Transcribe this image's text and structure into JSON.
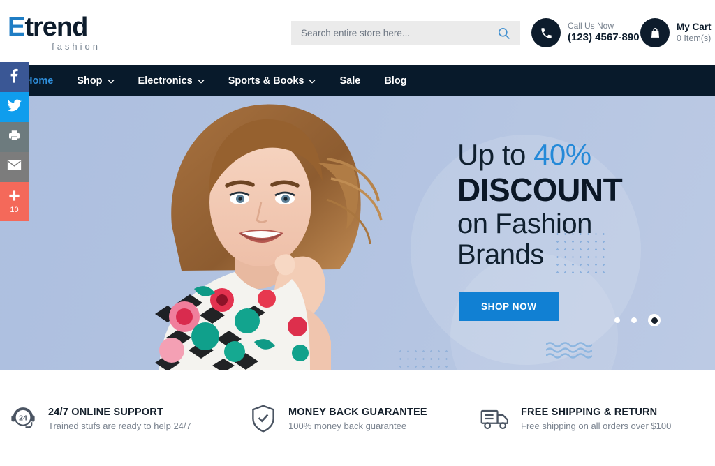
{
  "brand": {
    "logo_primary": "E",
    "logo_rest": "trend",
    "logo_sub": "fashion"
  },
  "search": {
    "placeholder": "Search entire store here...",
    "value": "",
    "icon": "search-icon"
  },
  "header": {
    "call": {
      "icon": "phone-icon",
      "label": "Call Us Now",
      "number": "(123) 4567-890"
    },
    "cart": {
      "icon": "shopping-bag-icon",
      "title": "My Cart",
      "count_label": "0 Item(s)"
    }
  },
  "nav": {
    "items": [
      {
        "label": "Home",
        "has_dropdown": false,
        "active": true
      },
      {
        "label": "Shop",
        "has_dropdown": true,
        "active": false
      },
      {
        "label": "Electronics",
        "has_dropdown": true,
        "active": false
      },
      {
        "label": "Sports & Books",
        "has_dropdown": true,
        "active": false
      },
      {
        "label": "Sale",
        "has_dropdown": false,
        "active": false
      },
      {
        "label": "Blog",
        "has_dropdown": false,
        "active": false
      }
    ]
  },
  "social_rail": {
    "items": [
      {
        "name": "facebook-icon",
        "color": "#3a5795"
      },
      {
        "name": "twitter-icon",
        "color": "#0f9ded"
      },
      {
        "name": "print-icon",
        "color": "#6d7b7e"
      },
      {
        "name": "email-icon",
        "color": "#7c7c7c"
      },
      {
        "name": "share-plus-icon",
        "color": "#f4695a",
        "count": "10"
      }
    ]
  },
  "hero": {
    "line1_prefix": "Up to ",
    "line1_accent": "40%",
    "line2": "DISCOUNT",
    "line3": "on Fashion",
    "line4": "Brands",
    "cta": "SHOP NOW",
    "accent_color": "#2489d8",
    "cta_color": "#1180d3",
    "background_color": "#b0c1e0",
    "slides": [
      {
        "active": false
      },
      {
        "active": false
      },
      {
        "active": true
      }
    ]
  },
  "features": [
    {
      "icon": "headset-24-icon",
      "title": "24/7 ONLINE SUPPORT",
      "subtitle": "Trained stufs are ready to help 24/7"
    },
    {
      "icon": "shield-check-icon",
      "title": "MONEY BACK GUARANTEE",
      "subtitle": "100% money back guarantee"
    },
    {
      "icon": "delivery-truck-icon",
      "title": "FREE SHIPPING & RETURN",
      "subtitle": "Free shipping on all orders over $100"
    }
  ]
}
